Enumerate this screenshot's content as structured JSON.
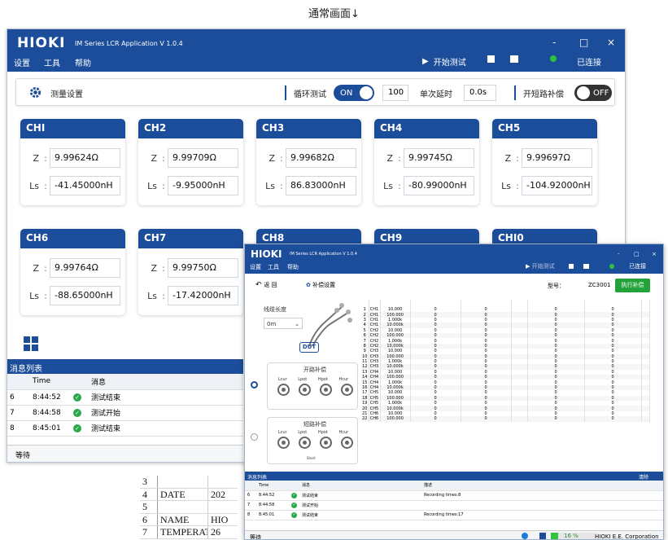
{
  "caption": "通常画面↓",
  "sheet": {
    "rows": [
      [
        "3",
        "",
        ""
      ],
      [
        "4",
        "DATE",
        "202"
      ],
      [
        "5",
        "",
        ""
      ],
      [
        "6",
        "NAME",
        "HIO"
      ],
      [
        "7",
        "TEMPERATUI",
        "26"
      ]
    ]
  },
  "main": {
    "logo": "HIOKI",
    "app_title": "IM Series LCR Application  V 1.0.4",
    "window_controls": {
      "minimize": "-",
      "maximize": "□",
      "close": "×"
    },
    "menu": [
      "设置",
      "工具",
      "帮助"
    ],
    "start_test": "开始测试",
    "connected": "已连接",
    "settings": {
      "label": "测量设置",
      "loop_label": "循环测试",
      "loop_state": "ON",
      "count": "100",
      "delay_label": "单次延时",
      "delay": "0.0s",
      "comp_label": "开短路补偿",
      "comp_state": "OFF"
    },
    "channels": [
      {
        "name": "CHI",
        "z": "9.99624Ω",
        "ls": "-41.45000nH"
      },
      {
        "name": "CH2",
        "z": "9.99709Ω",
        "ls": "-9.95000nH"
      },
      {
        "name": "CH3",
        "z": "9.99682Ω",
        "ls": "86.83000nH"
      },
      {
        "name": "CH4",
        "z": "9.99745Ω",
        "ls": "-80.99000nH"
      },
      {
        "name": "CH5",
        "z": "9.99697Ω",
        "ls": "-104.92000nH"
      },
      {
        "name": "CH6",
        "z": "9.99764Ω",
        "ls": "-88.65000nH"
      },
      {
        "name": "CH7",
        "z": "9.99750Ω",
        "ls": "-17.42000nH"
      },
      {
        "name": "CH8",
        "z": "",
        "ls": ""
      },
      {
        "name": "CH9",
        "z": "",
        "ls": ""
      },
      {
        "name": "CHI0",
        "z": "",
        "ls": ""
      }
    ],
    "param_z": "Z",
    "param_ls": "Ls",
    "colon": ":",
    "messages": {
      "title": "消息列表",
      "col_time": "Time",
      "col_msg": "消息",
      "rows": [
        {
          "id": "6",
          "time": "8:44:52",
          "msg": "测试结束"
        },
        {
          "id": "7",
          "time": "8:44:58",
          "msg": "测试开始"
        },
        {
          "id": "8",
          "time": "8:45:01",
          "msg": "测试结束"
        }
      ]
    },
    "status": "等待"
  },
  "comp": {
    "logo": "HIOKI",
    "app_title": "IM Series LCR Application  V 1.0.4",
    "window_controls": {
      "minimize": "-",
      "maximize": "□",
      "close": "×"
    },
    "menu": [
      "设置",
      "工具",
      "帮助"
    ],
    "start_test": "开始测试",
    "connected": "已连接",
    "back": "返 回",
    "settings": "补偿设置",
    "model_label": "型号：",
    "model": "ZC3001",
    "run": "执行补偿",
    "cable_len_label": "线缆长度",
    "cable_len": "0m",
    "dut": "DUT",
    "open_label": "开路补偿",
    "short_label": "短路补偿",
    "terminals": [
      "Lcur",
      "Lpot",
      "Hpot",
      "Hcur"
    ],
    "short_tag": "Short",
    "table": {
      "headers": [
        "ID",
        "CH",
        "Frequency[Hz]",
        "R [Ω]",
        "X [Ω]",
        "",
        "G [S]",
        "B [S]",
        "+"
      ],
      "rows": [
        [
          "1",
          "CH1",
          "10.000",
          "0",
          "0",
          "0",
          "0"
        ],
        [
          "2",
          "CH1",
          "100.000",
          "0",
          "0",
          "0",
          "0"
        ],
        [
          "3",
          "CH1",
          "1.000k",
          "0",
          "0",
          "0",
          "0"
        ],
        [
          "4",
          "CH1",
          "10.000k",
          "0",
          "0",
          "0",
          "0"
        ],
        [
          "5",
          "CH2",
          "10.000",
          "0",
          "0",
          "0",
          "0"
        ],
        [
          "6",
          "CH2",
          "100.000",
          "0",
          "0",
          "0",
          "0"
        ],
        [
          "7",
          "CH2",
          "1.000k",
          "0",
          "0",
          "0",
          "0"
        ],
        [
          "8",
          "CH2",
          "10.000k",
          "0",
          "0",
          "0",
          "0"
        ],
        [
          "9",
          "CH3",
          "10.000",
          "0",
          "0",
          "0",
          "0"
        ],
        [
          "10",
          "CH3",
          "100.000",
          "0",
          "0",
          "0",
          "0"
        ],
        [
          "11",
          "CH3",
          "1.000k",
          "0",
          "0",
          "0",
          "0"
        ],
        [
          "12",
          "CH3",
          "10.000k",
          "0",
          "0",
          "0",
          "0"
        ],
        [
          "13",
          "CH4",
          "10.000",
          "0",
          "0",
          "0",
          "0"
        ],
        [
          "14",
          "CH4",
          "100.000",
          "0",
          "0",
          "0",
          "0"
        ],
        [
          "15",
          "CH4",
          "1.000k",
          "0",
          "0",
          "0",
          "0"
        ],
        [
          "16",
          "CH4",
          "10.000k",
          "0",
          "0",
          "0",
          "0"
        ],
        [
          "17",
          "CH5",
          "10.000",
          "0",
          "0",
          "0",
          "0"
        ],
        [
          "18",
          "CH5",
          "100.000",
          "0",
          "0",
          "0",
          "0"
        ],
        [
          "19",
          "CH5",
          "1.000k",
          "0",
          "0",
          "0",
          "0"
        ],
        [
          "20",
          "CH5",
          "10.000k",
          "0",
          "0",
          "0",
          "0"
        ],
        [
          "21",
          "CH6",
          "10.000",
          "0",
          "0",
          "0",
          "0"
        ],
        [
          "22",
          "CH6",
          "100.000",
          "0",
          "0",
          "0",
          "0"
        ]
      ]
    },
    "messages": {
      "title": "消息列表",
      "clear": "清除",
      "col_time": "Time",
      "col_msg": "消息",
      "col_desc": "描述",
      "rows": [
        {
          "id": "6",
          "time": "8:44:52",
          "msg": "测试结束",
          "desc": "Recording times:8"
        },
        {
          "id": "7",
          "time": "8:44:58",
          "msg": "测试开始",
          "desc": ""
        },
        {
          "id": "8",
          "time": "8:45:01",
          "msg": "测试结束",
          "desc": "Recording times:17"
        }
      ]
    },
    "status": "等待",
    "progress": "16 %",
    "company": "HIOKI E.E. Corporation"
  },
  "colors": {
    "brand": "#1c4d9a",
    "ok": "#31c33d",
    "run": "#23a33a"
  }
}
